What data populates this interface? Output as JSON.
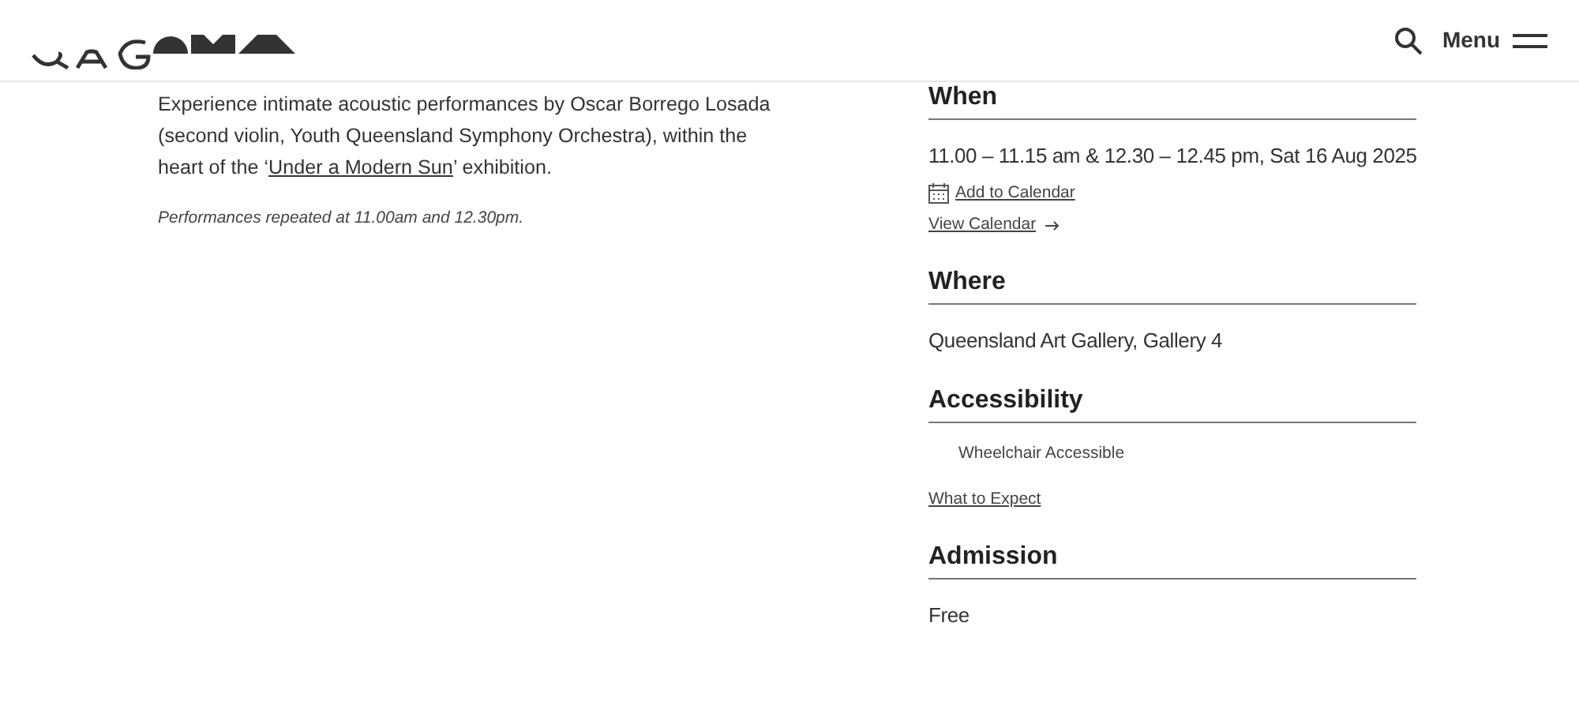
{
  "header": {
    "menu_label": "Menu"
  },
  "description": {
    "before": "Experience intimate acoustic performances by Oscar Borrego Losada (second violin, Youth Queensland Symphony Orchestra), within the heart of the ‘",
    "link": "Under a Modern Sun",
    "after": "’ exhibition."
  },
  "note": "Performances repeated at 11.00am and 12.30pm.",
  "sections": [
    {
      "heading": "When",
      "items": [
        {
          "kind": "text",
          "text": "11.00 – 11.15 am & 12.30 – 12.45 pm, Sat 16 Aug 2025"
        },
        {
          "kind": "calendar-link",
          "text": "Add to Calendar"
        },
        {
          "kind": "arrow-link",
          "text": "View Calendar"
        }
      ]
    },
    {
      "heading": "Where",
      "items": [
        {
          "kind": "text",
          "text": "Queensland Art Gallery, Gallery 4"
        }
      ]
    },
    {
      "heading": "Accessibility",
      "items": [
        {
          "kind": "feature",
          "text": "Wheelchair Accessible"
        },
        {
          "kind": "link",
          "text": "What to Expect"
        }
      ]
    },
    {
      "heading": "Admission",
      "items": [
        {
          "kind": "text",
          "text": "Free"
        }
      ]
    }
  ]
}
